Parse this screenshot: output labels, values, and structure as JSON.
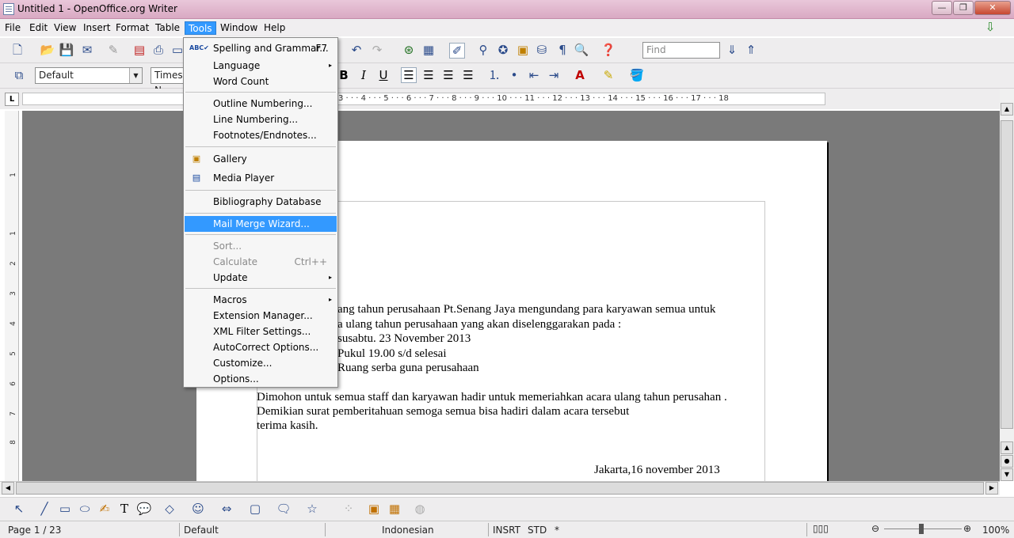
{
  "window": {
    "title": "Untitled 1 - OpenOffice.org Writer",
    "min": "—",
    "max": "❐",
    "close": "✕"
  },
  "menubar": [
    "File",
    "Edit",
    "View",
    "Insert",
    "Format",
    "Table",
    "Tools",
    "Window",
    "Help"
  ],
  "toolbar": {
    "find_placeholder": "Find",
    "style_value": "Default",
    "font_value": "Times N"
  },
  "ruler": {
    "corner": "L",
    "marks": "3 · · · 4 · · · 5 · · · 6 · · · 7 · · · 8 · · · 9 · · · 10 · · · 11 · · · 12 · · · 13 · · · 14 · · · 15 · · · 16 · · · 17 · · · 18",
    "vmarks": [
      "1",
      "1",
      "2",
      "3",
      "4",
      "5",
      "6",
      "7",
      "8"
    ]
  },
  "tools_menu": {
    "items": [
      {
        "label": "Spelling and Grammar...",
        "shortcut": "F7",
        "icon": "abc-check-icon"
      },
      {
        "label": "Language",
        "submenu": "▸"
      },
      {
        "label": "Word Count"
      },
      {
        "label": "Outline Numbering..."
      },
      {
        "label": "Line Numbering..."
      },
      {
        "label": "Footnotes/Endnotes..."
      },
      {
        "label": "Gallery",
        "icon": "gallery-icon"
      },
      {
        "label": "Media Player",
        "icon": "media-player-icon"
      },
      {
        "label": "Bibliography Database"
      },
      {
        "label": "Mail Merge Wizard..."
      },
      {
        "label": "Sort..."
      },
      {
        "label": "Calculate",
        "shortcut": "Ctrl++"
      },
      {
        "label": "Update",
        "submenu": "▸"
      },
      {
        "label": "Macros",
        "submenu": "▸"
      },
      {
        "label": "Extension Manager..."
      },
      {
        "label": "XML Filter Settings..."
      },
      {
        "label": "AutoCorrect Options..."
      },
      {
        "label": "Customize..."
      },
      {
        "label": "Options..."
      }
    ]
  },
  "document": {
    "lines": [
      "ang tahun perusahaan Pt.Senang Jaya mengundang para karyawan semua untuk",
      "a ulang tahun perusahaan yang akan diselenggarakan pada :",
      "susabtu. 23 November 2013",
      "Pukul 19.00 s/d selesai",
      "Ruang serba guna perusahaan",
      "Dimohon untuk semua staff dan karyawan hadir untuk memeriahkan acara ulang tahun perusahan .",
      "Demikian surat pemberitahuan semoga semua bisa hadiri dalam acara tersebut",
      "terima kasih.",
      "Jakarta,16 november 2013"
    ]
  },
  "statusbar": {
    "page": "Page 1 / 23",
    "style": "Default",
    "language": "Indonesian",
    "insert_mode": "INSRT",
    "selection_mode": "STD",
    "modified": "*",
    "zoom": "100%"
  }
}
